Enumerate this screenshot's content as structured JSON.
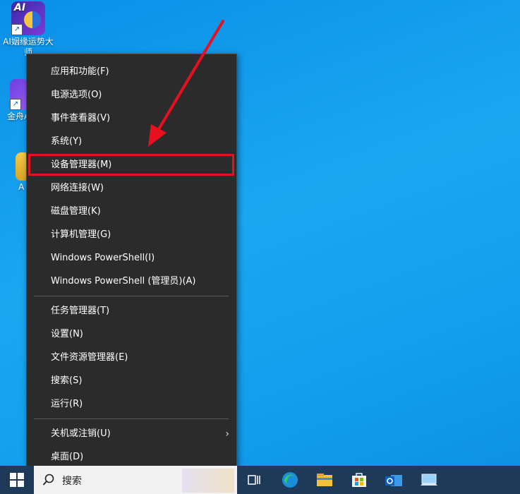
{
  "desktop": {
    "icons": [
      {
        "label": "AI姻缘运势大师",
        "badge": "AI"
      },
      {
        "label": "金舟A"
      },
      {
        "label": "A"
      }
    ]
  },
  "context_menu": {
    "items": [
      {
        "label": "应用和功能(F)"
      },
      {
        "label": "电源选项(O)"
      },
      {
        "label": "事件查看器(V)"
      },
      {
        "label": "系统(Y)"
      },
      {
        "label": "设备管理器(M)",
        "highlighted": true
      },
      {
        "label": "网络连接(W)"
      },
      {
        "label": "磁盘管理(K)"
      },
      {
        "label": "计算机管理(G)"
      },
      {
        "label": "Windows PowerShell(I)"
      },
      {
        "label": "Windows PowerShell (管理员)(A)"
      },
      {
        "label": "任务管理器(T)"
      },
      {
        "label": "设置(N)"
      },
      {
        "label": "文件资源管理器(E)"
      },
      {
        "label": "搜索(S)"
      },
      {
        "label": "运行(R)"
      },
      {
        "label": "关机或注销(U)",
        "submenu": true
      },
      {
        "label": "桌面(D)"
      }
    ],
    "highlight_color": "#e0141e"
  },
  "annotation": {
    "arrow_color": "#e8101e"
  },
  "taskbar": {
    "search_placeholder": "搜索",
    "icons": [
      "start-windows-icon",
      "search-icon",
      "task-view-icon",
      "edge-icon",
      "file-explorer-icon",
      "store-icon",
      "outlook-icon",
      "remote-desktop-icon"
    ]
  }
}
